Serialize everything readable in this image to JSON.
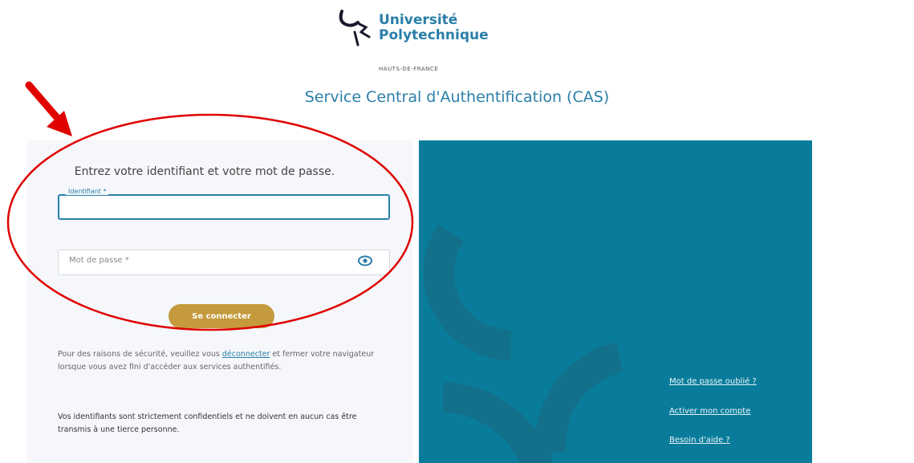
{
  "logo": {
    "line1": "Université",
    "line2": "Polytechnique",
    "line3": "HAUTS-DE-FRANCE"
  },
  "cas_title": "Service Central d'Authentification (CAS)",
  "form": {
    "instruction": "Entrez votre identifiant et votre mot de passe.",
    "username_label": "Identifiant *",
    "username_value": "",
    "password_placeholder": "Mot de passe *",
    "password_value": "",
    "submit_label": "Se connecter"
  },
  "security_note": {
    "before": "Pour des raisons de sécurité, veuillez vous ",
    "link": "déconnecter",
    "after": " et fermer votre navigateur lorsque vous avez fini d'accéder aux services authentifiés."
  },
  "confidential_note": "Vos identifiants sont strictement confidentiels et ne doivent en aucun cas être transmis à une tierce personne.",
  "right_links": {
    "forgot": "Mot de passe oublié ?",
    "activate": "Activer mon compte",
    "help": "Besoin d'aide ?"
  },
  "colors": {
    "brand_blue": "#2a7fa9",
    "panel_teal": "#097c9b",
    "button_gold": "#c49a3c",
    "annotation_red": "#e00000"
  },
  "icons": {
    "logo": "upf-logo-icon",
    "password_toggle": "eye-icon",
    "annotation_arrow": "arrow-icon"
  }
}
